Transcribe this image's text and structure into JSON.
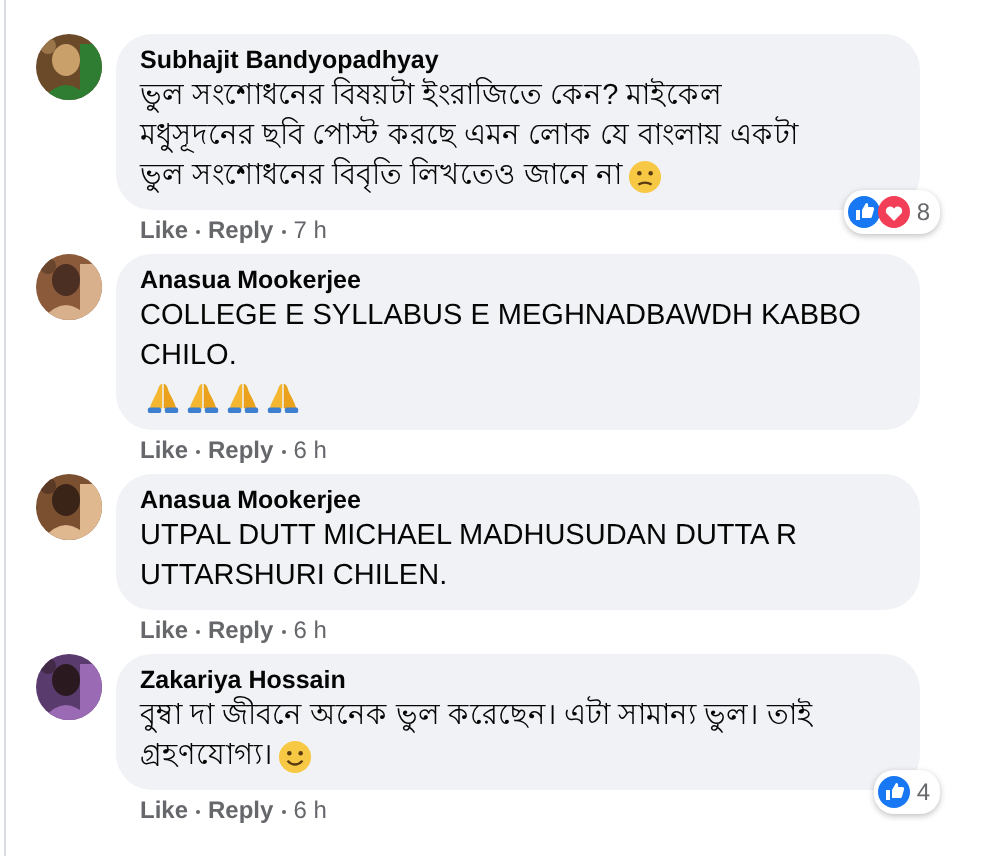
{
  "comments": [
    {
      "author": "Subhajit Bandyopadhyay",
      "paragraphs": [
        [
          {
            "kind": "text",
            "lines": [
              "ভুল সংশোধনের বিষয়টা ইংরাজিতে কেন? মাইকেল",
              "মধুসূদনের ছবি পোস্ট করছে এমন লোক যে বাংলায় একটা",
              "ভুল সংশোধনের বিবৃতি লিখতেও জানে না"
            ]
          },
          {
            "kind": "frown"
          }
        ]
      ],
      "actions": [
        "Like",
        "Reply",
        "7 h"
      ],
      "reactions": {
        "icons": [
          {
            "kind": "like"
          },
          {
            "kind": "love"
          }
        ],
        "count": "8"
      }
    },
    {
      "author": "Anasua Mookerjee",
      "paragraphs": [
        [
          {
            "kind": "text",
            "lines": [
              "COLLEGE E SYLLABUS E MEGHNADBAWDH KABBO",
              "CHILO."
            ]
          }
        ],
        [
          {
            "kind": "pray"
          },
          {
            "kind": "pray"
          },
          {
            "kind": "pray"
          },
          {
            "kind": "pray"
          }
        ]
      ],
      "actions": [
        "Like",
        "Reply",
        "6 h"
      ]
    },
    {
      "author": "Anasua Mookerjee",
      "paragraphs": [
        [
          {
            "kind": "text",
            "lines": [
              "UTPAL DUTT MICHAEL MADHUSUDAN DUTTA R",
              "UTTARSHURI CHILEN."
            ]
          }
        ]
      ],
      "actions": [
        "Like",
        "Reply",
        "6 h"
      ]
    },
    {
      "author": "Zakariya Hossain",
      "paragraphs": [
        [
          {
            "kind": "text",
            "lines": [
              "বুম্বা দা জীবনে অনেক ভুল করেছেন। এটা সামান্য ভুল। তাই",
              "গ্রহণযোগ্য।"
            ]
          },
          {
            "kind": "smile"
          }
        ]
      ],
      "actions": [
        "Like",
        "Reply",
        "6 h"
      ],
      "reactions": {
        "icons": [
          {
            "kind": "like"
          }
        ],
        "count": "4"
      }
    }
  ]
}
